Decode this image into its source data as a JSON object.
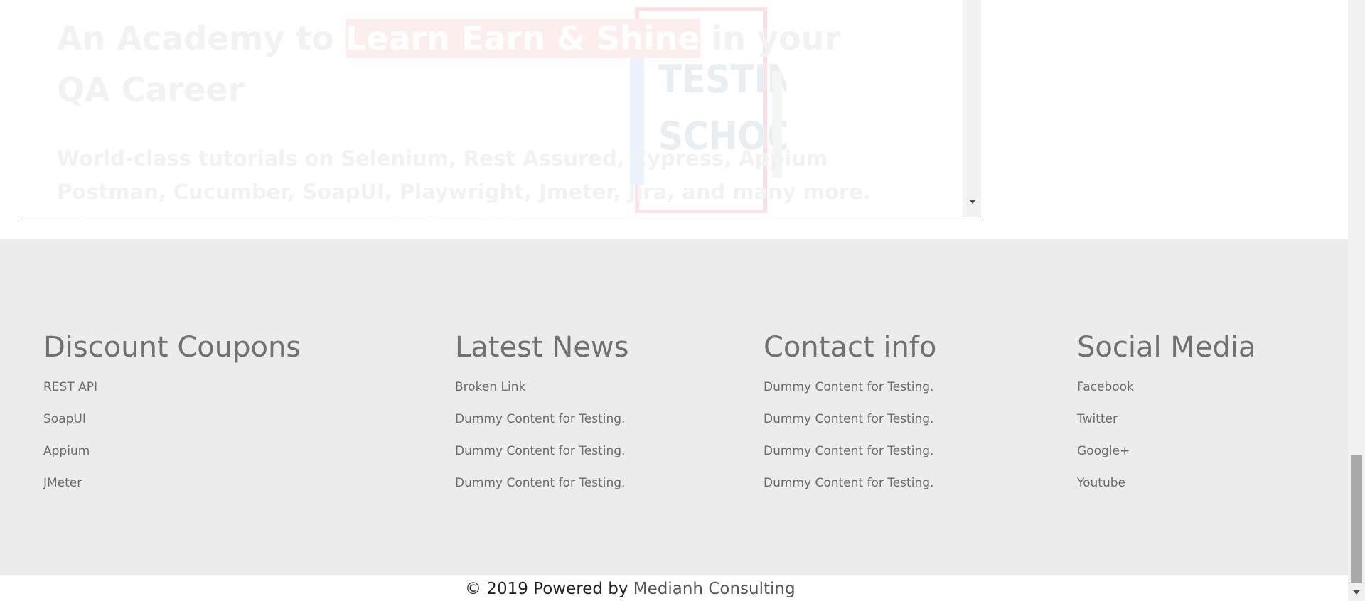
{
  "hero": {
    "title_before": "An Academy to ",
    "title_highlight": "Learn Earn & Shine",
    "title_after": "  in your QA Career",
    "text": "World-class tutorials on Selenium, Rest Assured, Cypress, Appium Postman, Cucumber, SoapUI, Playwright, Jmeter, Jira, and many more. Join our courses now to get the best job",
    "logo_line1": "TESTING",
    "logo_line2": "SCHOOL"
  },
  "footer": {
    "discount": {
      "heading": "Discount Coupons",
      "items": [
        "REST API",
        "SoapUI",
        "Appium",
        "JMeter"
      ]
    },
    "news": {
      "heading": "Latest News",
      "items": [
        "Broken Link",
        "Dummy Content for Testing.",
        "Dummy Content for Testing.",
        "Dummy Content for Testing."
      ]
    },
    "contact": {
      "heading": "Contact info",
      "items": [
        "Dummy Content for Testing.",
        "Dummy Content for Testing.",
        "Dummy Content for Testing.",
        "Dummy Content for Testing."
      ]
    },
    "social": {
      "heading": "Social Media",
      "items": [
        "Facebook",
        "Twitter",
        "Google+",
        "Youtube"
      ]
    }
  },
  "copyright": {
    "prefix": "© 2019 Powered by ",
    "company": "Medianh Consulting"
  },
  "colors": {
    "footer_bg": "#ececec",
    "heading": "#707070",
    "link": "#6b6b6b"
  }
}
